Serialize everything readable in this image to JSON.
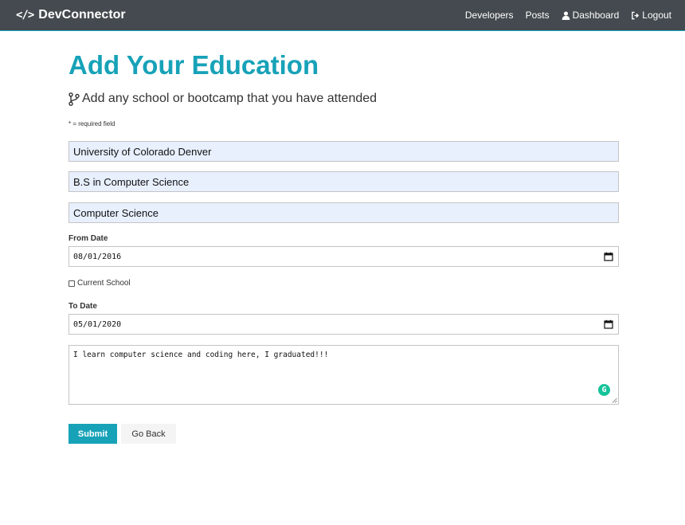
{
  "navbar": {
    "brand": "DevConnector",
    "brand_icon": "code-icon",
    "links": [
      {
        "label": "Developers",
        "icon": ""
      },
      {
        "label": "Posts",
        "icon": ""
      },
      {
        "label": "Dashboard",
        "icon": "user-icon"
      },
      {
        "label": "Logout",
        "icon": "sign-out-icon"
      }
    ],
    "bg_color": "#444a4f",
    "accent_color": "#17a2b8"
  },
  "page": {
    "title": "Add Your Education",
    "lead": "Add any school or bootcamp that you have attended",
    "lead_icon": "code-branch-icon",
    "required_note": "* = required field"
  },
  "form": {
    "school": "University of Colorado Denver",
    "degree": "B.S in Computer Science",
    "field_of_study": "Computer Science",
    "from_label": "From Date",
    "from_date": "08/01/2016",
    "current_label": "Current School",
    "current_checked": false,
    "to_label": "To Date",
    "to_date": "05/01/2020",
    "description": "I learn computer science and coding here, I graduated!!!",
    "submit_label": "Submit",
    "back_label": "Go Back"
  }
}
